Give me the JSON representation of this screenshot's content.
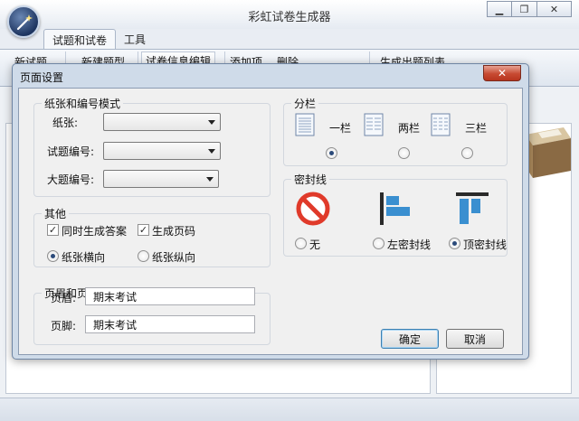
{
  "app": {
    "title": "彩虹试卷生成器",
    "menu_tabs": [
      {
        "label": "试题和试卷",
        "active": true
      },
      {
        "label": "工具",
        "active": false
      }
    ],
    "ribbon_groups": [
      "新试题",
      "新建题型",
      "试卷信息编辑",
      "添加项",
      "删除",
      "生成出题列表"
    ],
    "window_controls": [
      "minimize-icon",
      "restore-icon",
      "close-icon"
    ]
  },
  "dialog": {
    "title": "页面设置",
    "close_glyph": "✕",
    "paper_group": {
      "title": "纸张和编号模式",
      "paper_label": "纸张:",
      "question_no_label": "试题编号:",
      "section_no_label": "大题编号:",
      "paper_value": "",
      "question_no_value": "",
      "section_no_value": ""
    },
    "other_group": {
      "title": "其他",
      "gen_answer_label": "同时生成答案",
      "gen_answer_checked": true,
      "gen_page_label": "生成页码",
      "gen_page_checked": true,
      "landscape_label": "纸张横向",
      "portrait_label": "纸张纵向",
      "orientation": "landscape"
    },
    "header_group": {
      "title": "页眉和页脚",
      "header_label": "页眉:",
      "header_value": "期末考试",
      "footer_label": "页脚:",
      "footer_value": "期末考试"
    },
    "columns_group": {
      "title": "分栏",
      "options": [
        {
          "label": "一栏",
          "selected": true
        },
        {
          "label": "两栏",
          "selected": false
        },
        {
          "label": "三栏",
          "selected": false
        }
      ]
    },
    "seal_group": {
      "title": "密封线",
      "options": [
        {
          "label": "无",
          "icon": "no-symbol-icon",
          "selected": false
        },
        {
          "label": "左密封线",
          "icon": "left-seal-line-icon",
          "selected": false
        },
        {
          "label": "顶密封线",
          "icon": "top-seal-line-icon",
          "selected": true
        }
      ]
    },
    "ok_label": "确定",
    "cancel_label": "取消"
  },
  "colors": {
    "accent": "#3c7fb1",
    "seal_blue": "#3a8fd0",
    "no_symbol_red": "#e03a2a"
  }
}
